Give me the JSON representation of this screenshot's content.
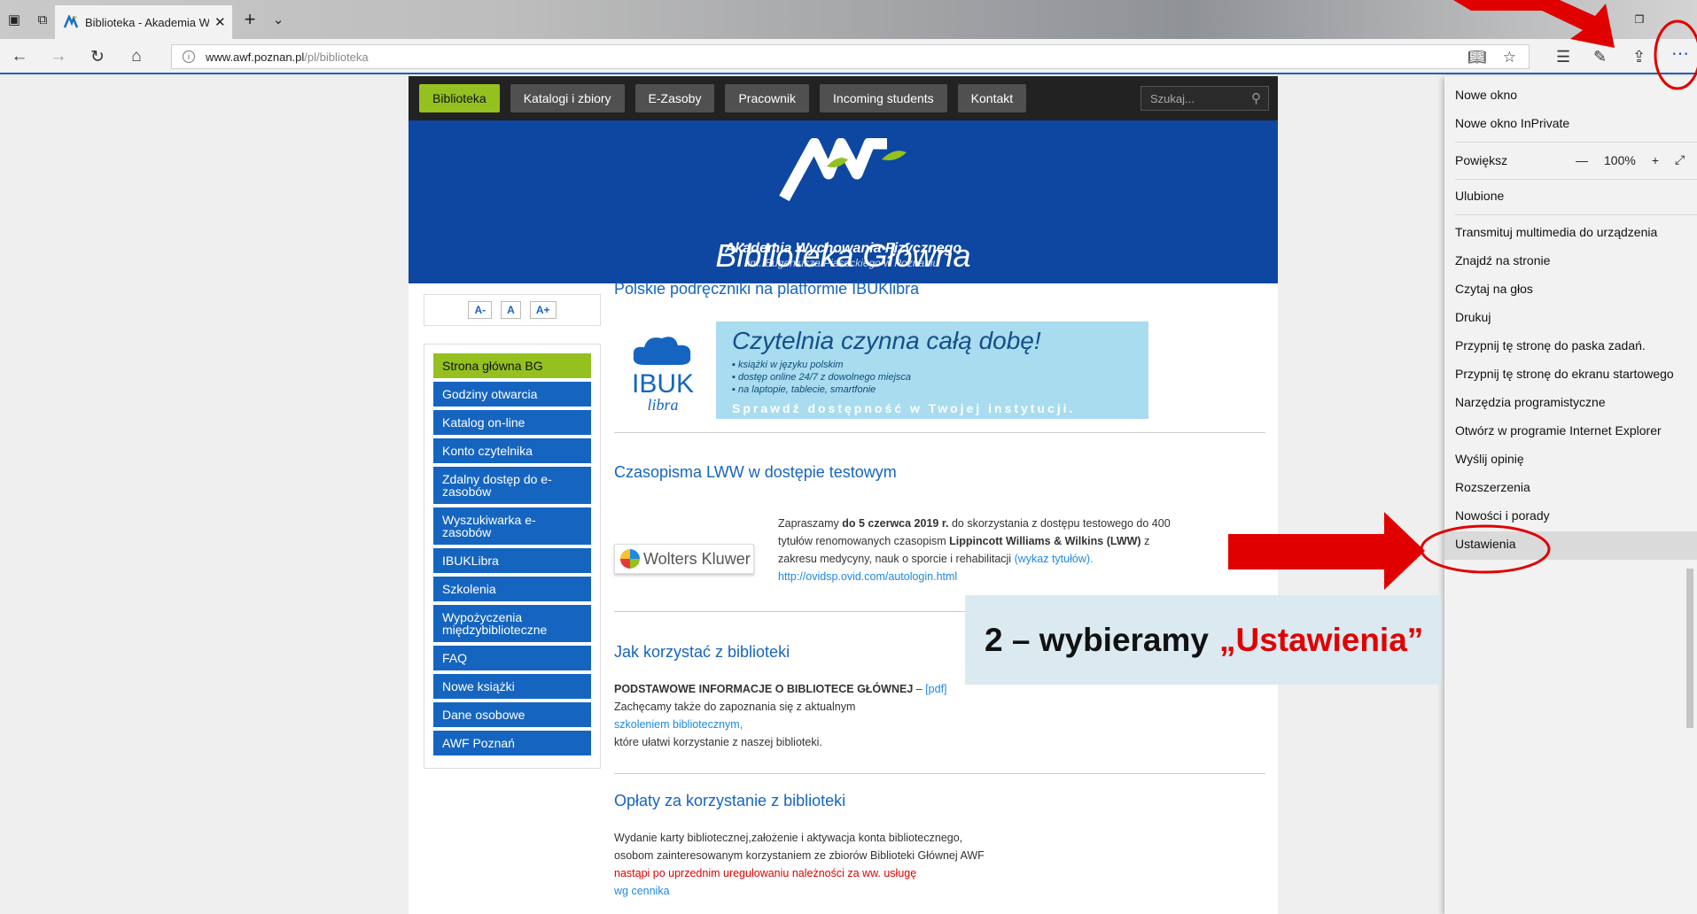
{
  "browser": {
    "tab_title": "Biblioteka - Akademia W",
    "url_host": "www.awf.poznan.pl",
    "url_path": "/pl/biblioteka"
  },
  "site": {
    "nav": [
      "Biblioteka",
      "Katalogi i zbiory",
      "E-Zasoby",
      "Pracownik",
      "Incoming students",
      "Kontakt"
    ],
    "search_placeholder": "Szukaj...",
    "hero_line1": "Akademia Wychowania Fizycznego",
    "hero_line2": "im. Eugeniusza Piaseckiego w Poznaniu",
    "hero_title": "Biblioteka Główna",
    "font_buttons": [
      "A-",
      "A",
      "A+"
    ],
    "menu": [
      "Strona główna BG",
      "Godziny otwarcia",
      "Katalog on-line",
      "Konto czytelnika",
      "Zdalny dostęp do e-zasobów",
      "Wyszukiwarka e-zasobów",
      "IBUKLibra",
      "Szkolenia",
      "Wypożyczenia międzybiblioteczne",
      "FAQ",
      "Nowe książki",
      "Dane osobowe",
      "AWF Poznań"
    ]
  },
  "content": {
    "s1_title": "Polskie podręczniki na platformie IBUKlibra",
    "ibuk_logo_top": "IBUK",
    "ibuk_logo_bottom": "libra",
    "banner_title": "Czytelnia czynna całą dobę!",
    "banner_bullets": [
      "książki w języku polskim",
      "dostęp online 24/7 z dowolnego miejsca",
      "na laptopie, tablecie, smartfonie"
    ],
    "banner_cta": "Sprawdź dostępność w Twojej instytucji.",
    "s2_title": "Czasopisma LWW w dostępie testowym",
    "wk_logo": "Wolters Kluwer",
    "s2_p1": "Zapraszamy",
    "s2_p1_bold": "do 5 czerwca 2019 r.",
    "s2_p1_rest": "do skorzystania z dostępu testowego do 400",
    "s2_p2": "tytułów renomowanych czasopism",
    "s2_p2_bold": "Lippincott Williams & Wilkins (LWW)",
    "s2_p2_rest": "z",
    "s2_p3": "zakresu medycyny, nauk o sporcie i rehabilitacji",
    "s2_p3_link": "(wykaz tytułów).",
    "s2_link": "http://ovidsp.ovid.com/autologin.html",
    "s3_title": "Jak korzystać z biblioteki",
    "s3_bold": "PODSTAWOWE INFORMACJE O BIBLIOTECE GŁÓWNEJ",
    "s3_dash": " – ",
    "s3_pdf": "[pdf]",
    "s3_l2": "Zachęcamy także do zapoznania się z aktualnym",
    "s3_l3": "szkoleniem bibliotecznym,",
    "s3_l4": "które ułatwi korzystanie z naszej biblioteki.",
    "s4_title": "Opłaty za korzystanie z biblioteki",
    "s4_l1": "Wydanie karty bibliotecznej,założenie i aktywacja konta bibliotecznego,",
    "s4_l2": "osobom zainteresowanym korzystaniem ze zbiorów Biblioteki Głównej AWF",
    "s4_l3": "nastąpi po uprzednim uregulowaniu należności za ww. usługę",
    "s4_l4": "wg cennika"
  },
  "edge_menu": {
    "new_window": "Nowe okno",
    "inprivate": "Nowe okno InPrivate",
    "zoom_label": "Powiększ",
    "zoom_value": "100%",
    "favorites": "Ulubione",
    "items": [
      "Transmituj multimedia do urządzenia",
      "Znajdź na stronie",
      "Czytaj na głos",
      "Drukuj",
      "Przypnij tę stronę do paska zadań.",
      "Przypnij tę stronę do ekranu startowego",
      "Narzędzia programistyczne",
      "Otwórz w programie Internet Explorer",
      "Wyślij opinię",
      "Rozszerzenia",
      "Nowości i porady",
      "Ustawienia"
    ]
  },
  "annotation": {
    "prefix": "2 – wybieramy",
    "highlight": "„Ustawienia”"
  },
  "colors": {
    "accent_green": "#94c11f",
    "nav_blue": "#1565c0",
    "hero_blue": "#0d47a1",
    "annotation_red": "#e10000"
  }
}
